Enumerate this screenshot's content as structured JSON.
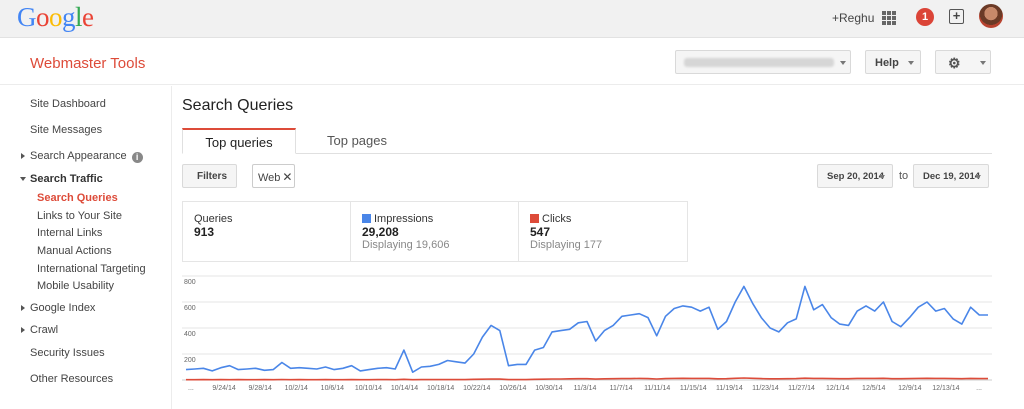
{
  "google_logo": [
    "G",
    "o",
    "o",
    "g",
    "l",
    "e"
  ],
  "topbar": {
    "user_link": "+Reghu",
    "notification_count": "1",
    "share_icon": "+"
  },
  "header": {
    "product_name": "Webmaster Tools",
    "help_label": "Help",
    "gear_icon": "⚙"
  },
  "sidebar": {
    "items": [
      {
        "label": "Site Dashboard"
      },
      {
        "label": "Site Messages"
      },
      {
        "label": "Search Appearance"
      },
      {
        "label": "Search Traffic"
      },
      {
        "label": "Search Queries"
      },
      {
        "label": "Links to Your Site"
      },
      {
        "label": "Internal Links"
      },
      {
        "label": "Manual Actions"
      },
      {
        "label": "International Targeting"
      },
      {
        "label": "Mobile Usability"
      },
      {
        "label": "Google Index"
      },
      {
        "label": "Crawl"
      },
      {
        "label": "Security Issues"
      },
      {
        "label": "Other Resources"
      }
    ]
  },
  "main": {
    "title": "Search Queries",
    "tabs": [
      {
        "label": "Top queries"
      },
      {
        "label": "Top pages"
      }
    ],
    "filters_label": "Filters",
    "chip": {
      "label": "Web",
      "close": "✕"
    },
    "date_from": "Sep 20, 2014",
    "date_to": "Dec 19, 2014",
    "to_label": "to"
  },
  "stats": {
    "queries": {
      "name": "Queries",
      "value": "913"
    },
    "impressions": {
      "name": "Impressions",
      "value": "29,208",
      "displaying": "Displaying 19,606",
      "color": "#4a86e8"
    },
    "clicks": {
      "name": "Clicks",
      "value": "547",
      "displaying": "Displaying 177",
      "color": "#dd4b39"
    }
  },
  "chart_data": {
    "type": "line",
    "ylim": [
      0,
      800
    ],
    "y_ticks": [
      "800",
      "600",
      "400",
      "200"
    ],
    "x_ticks": [
      "...",
      "9/24/14",
      "9/28/14",
      "10/2/14",
      "10/6/14",
      "10/10/14",
      "10/14/14",
      "10/18/14",
      "10/22/14",
      "10/26/14",
      "10/30/14",
      "11/3/14",
      "11/7/14",
      "11/11/14",
      "11/15/14",
      "11/19/14",
      "11/23/14",
      "11/27/14",
      "12/1/14",
      "12/5/14",
      "12/9/14",
      "12/13/14",
      "..."
    ],
    "series": [
      {
        "name": "Impressions",
        "color": "#4a86e8",
        "values": [
          80,
          85,
          90,
          70,
          95,
          110,
          80,
          85,
          90,
          75,
          80,
          135,
          90,
          95,
          90,
          85,
          100,
          80,
          90,
          110,
          70,
          80,
          90,
          95,
          85,
          230,
          60,
          100,
          105,
          120,
          150,
          140,
          130,
          200,
          330,
          420,
          380,
          110,
          120,
          120,
          230,
          250,
          370,
          380,
          390,
          440,
          450,
          300,
          380,
          420,
          490,
          500,
          510,
          480,
          340,
          490,
          550,
          570,
          560,
          530,
          560,
          390,
          450,
          600,
          720,
          590,
          480,
          400,
          370,
          440,
          470,
          720,
          540,
          580,
          480,
          430,
          420,
          530,
          570,
          530,
          600,
          450,
          410,
          480,
          560,
          600,
          530,
          550,
          470,
          430,
          560,
          500,
          500
        ]
      },
      {
        "name": "Clicks",
        "color": "#dd4b39",
        "values": [
          2,
          2,
          3,
          2,
          3,
          2,
          3,
          2,
          2,
          3,
          2,
          4,
          2,
          3,
          2,
          2,
          3,
          2,
          2,
          3,
          2,
          2,
          3,
          3,
          2,
          5,
          2,
          3,
          3,
          3,
          4,
          3,
          3,
          5,
          6,
          8,
          7,
          3,
          3,
          3,
          5,
          6,
          8,
          8,
          9,
          10,
          10,
          7,
          9,
          10,
          11,
          11,
          12,
          11,
          8,
          11,
          12,
          13,
          12,
          12,
          12,
          9,
          10,
          13,
          15,
          13,
          11,
          9,
          9,
          10,
          11,
          14,
          12,
          12,
          11,
          10,
          10,
          12,
          12,
          12,
          13,
          10,
          10,
          11,
          12,
          13,
          12,
          12,
          11,
          10,
          12,
          11,
          11
        ]
      }
    ]
  }
}
